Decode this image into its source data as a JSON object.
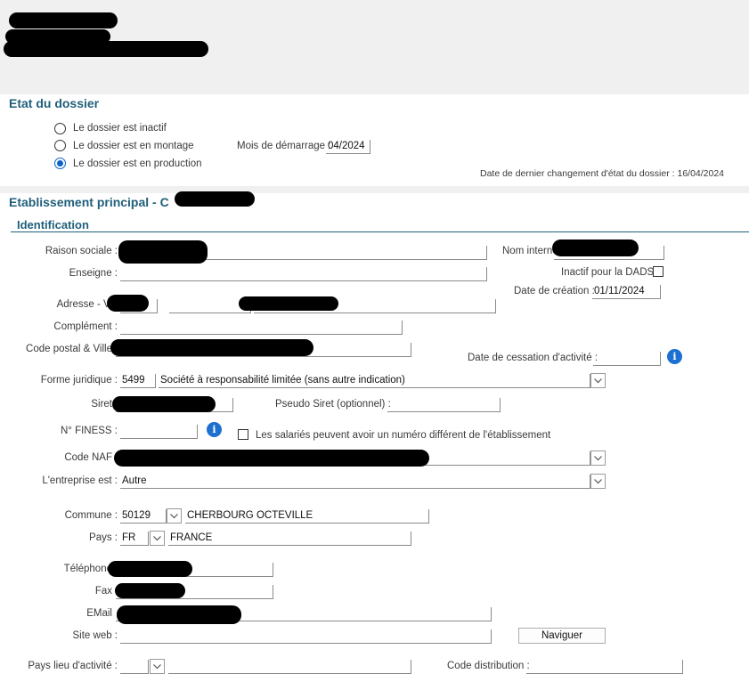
{
  "etat": {
    "title": "Etat du dossier",
    "options": [
      {
        "label": "Le dossier est inactif",
        "checked": false
      },
      {
        "label": "Le dossier est en montage",
        "checked": false
      },
      {
        "label": "Le dossier est en production",
        "checked": true
      }
    ],
    "mois_label": "Mois de démarrage :",
    "mois_value": "04/2024",
    "date_changement": "Date de dernier changement d'état du dossier : 16/04/2024"
  },
  "etab": {
    "title": "Etablissement principal - C",
    "subtitle": "Identification"
  },
  "form": {
    "raison_sociale": "Raison sociale :",
    "enseigne": "Enseigne :",
    "adresse": "Adresse - Voi",
    "complement": "Complément :",
    "cp_ville": "Code postal & Ville",
    "forme_juridique": "Forme juridique :",
    "forme_code": "5499",
    "forme_value": "Société à responsabilité limitée (sans autre indication)",
    "siret": "Siret",
    "pseudo_siret": "Pseudo Siret (optionnel) :",
    "finess": "N° FINESS :",
    "salaries_label": "Les salariés peuvent avoir un numéro différent de l'établissement",
    "naf": "Code NAF",
    "entreprise_est": "L'entreprise est :",
    "entreprise_value": "Autre",
    "commune": "Commune :",
    "commune_code": "50129",
    "commune_name": "CHERBOURG OCTEVILLE",
    "pays": "Pays :",
    "pays_code": "FR",
    "pays_name": "FRANCE",
    "telephone": "Téléphone",
    "fax": "Fax",
    "email": "EMail",
    "site_web": "Site web :",
    "naviguer": "Naviguer",
    "pays_lieu": "Pays lieu d'activité :",
    "code_distribution": "Code distribution :",
    "nom_interne": "Nom interne",
    "inactif_dads": "Inactif pour la DADS",
    "date_creation": "Date de création :",
    "date_creation_value": "01/11/2024",
    "date_cessation": "Date de cessation d'activité :"
  },
  "icons": [
    "radio-icon",
    "checkbox-icon",
    "chevron-down-icon",
    "info-icon"
  ],
  "colors": {
    "accent": "#1f5f7a",
    "radio": "#0a64c8",
    "info": "#1d6fd0",
    "band": "#f0f0f0"
  }
}
